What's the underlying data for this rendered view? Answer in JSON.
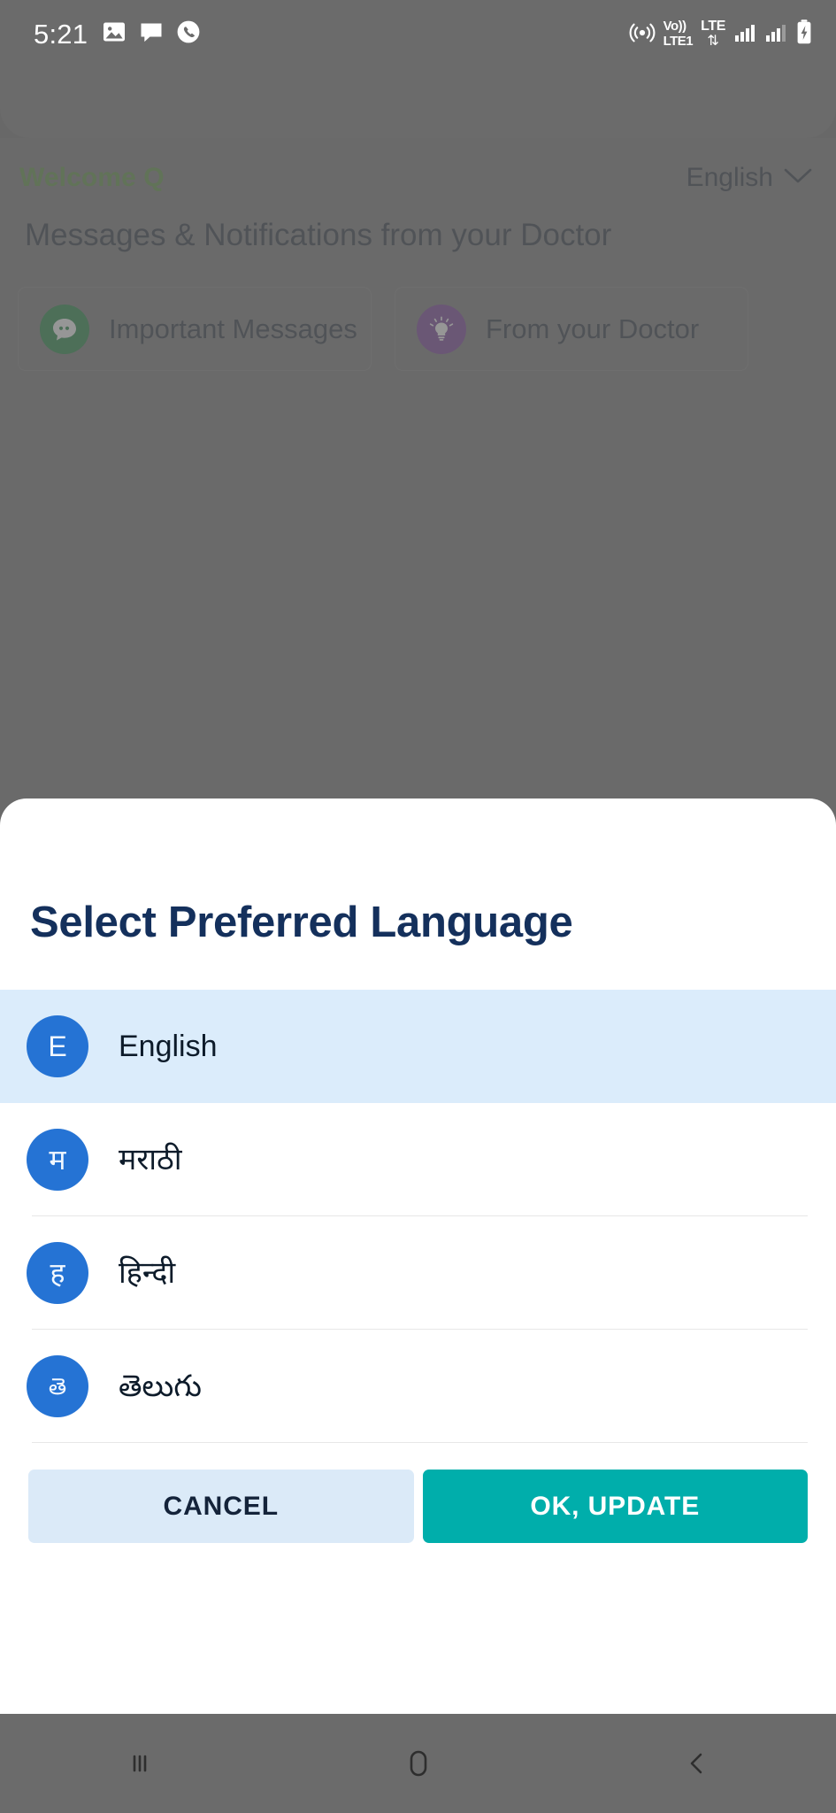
{
  "status_bar": {
    "time": "5:21",
    "left_icons": [
      "gallery-icon",
      "messages-icon",
      "phone-icon"
    ],
    "network": {
      "hotspot": "hotspot-icon",
      "volte_top": "Vo))",
      "volte_bottom": "LTE1",
      "lte_label": "LTE",
      "data_arrows": "⇅",
      "signal_1": "signal-bars-icon",
      "signal_2": "signal-bars-icon",
      "battery": "battery-charging-icon"
    }
  },
  "app": {
    "welcome_text": "Welcome Q",
    "language_selector": {
      "label": "English",
      "chevron": "chevron-down-icon"
    },
    "section_title": "Messages & Notifications from your Doctor",
    "cards": [
      {
        "label": "Important Messages",
        "icon": "chat-bubble-icon",
        "color": "#0a7c2f"
      },
      {
        "label": "From your Doctor",
        "icon": "lightbulb-icon",
        "color": "#6b2d90"
      }
    ]
  },
  "sheet": {
    "title": "Select Preferred Language",
    "languages": [
      {
        "initial": "E",
        "name": "English",
        "selected": true
      },
      {
        "initial": "म",
        "name": "मराठी",
        "selected": false
      },
      {
        "initial": "ह",
        "name": "हिन्दी",
        "selected": false
      },
      {
        "initial": "తె",
        "name": "తెలుగు",
        "selected": false
      }
    ],
    "cancel_label": "CANCEL",
    "ok_label": "OK, UPDATE"
  },
  "nav_bar": {
    "recents": "recents-icon",
    "home": "home-icon",
    "back": "back-icon"
  },
  "colors": {
    "accent_teal": "#00aeab",
    "accent_blue": "#2573d4",
    "selected_row_bg": "#dbecfb",
    "cancel_bg": "#dbeaf8",
    "title_navy": "#14305c",
    "welcome_green": "#4f8a2f"
  }
}
